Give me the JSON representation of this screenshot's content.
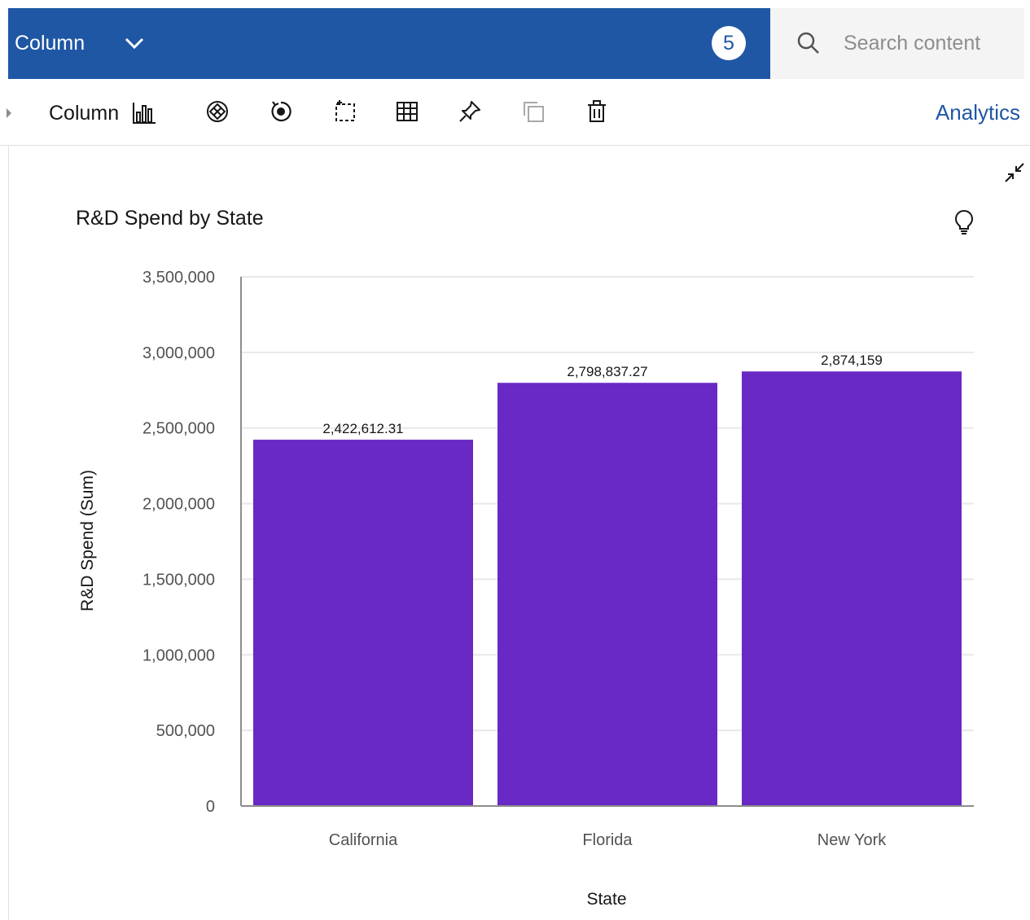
{
  "header": {
    "title": "Column",
    "badge": "5"
  },
  "search": {
    "placeholder": "Search content"
  },
  "toolbar": {
    "type_label": "Column",
    "analytics_label": "Analytics",
    "tools": [
      "target-icon",
      "refresh-icon",
      "select-icon",
      "table-icon",
      "pin-icon",
      "duplicate-icon",
      "delete-icon"
    ]
  },
  "colors": {
    "header_bg": "#1f57a4",
    "bar": "#6929c4",
    "accent": "#1f57a4"
  },
  "chart_data": {
    "type": "bar",
    "title": "R&D Spend by State",
    "xlabel": "State",
    "ylabel": "R&D Spend (Sum)",
    "categories": [
      "California",
      "Florida",
      "New York"
    ],
    "values": [
      2422612.31,
      2798837.27,
      2874159
    ],
    "value_labels": [
      "2,422,612.31",
      "2,798,837.27",
      "2,874,159"
    ],
    "ylim": [
      0,
      3500000
    ],
    "yticks": [
      0,
      500000,
      1000000,
      1500000,
      2000000,
      2500000,
      3000000,
      3500000
    ],
    "ytick_labels": [
      "0",
      "500,000",
      "1,000,000",
      "1,500,000",
      "2,000,000",
      "2,500,000",
      "3,000,000",
      "3,500,000"
    ],
    "grid": true,
    "legend": "none"
  }
}
